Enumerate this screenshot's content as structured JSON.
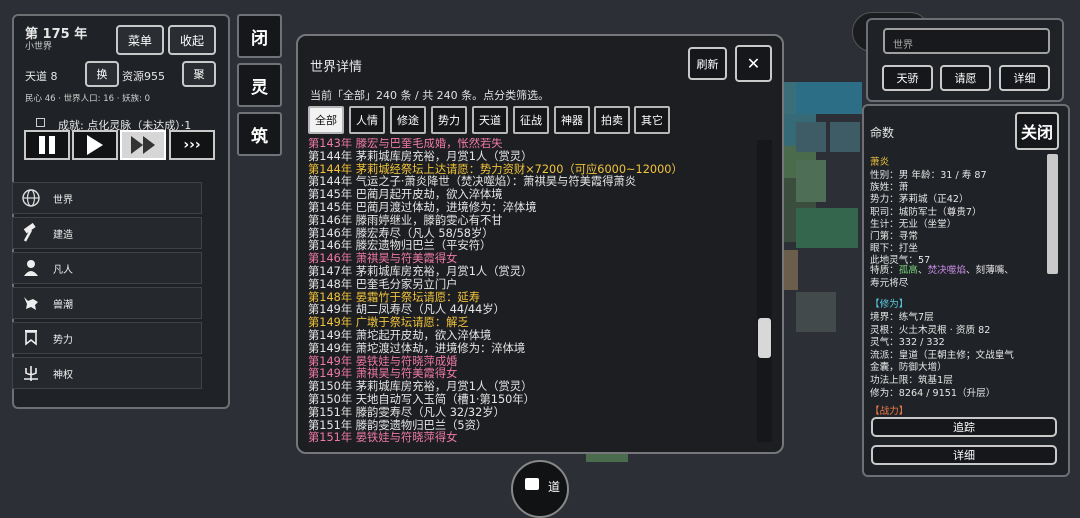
{
  "top_left": {
    "year": "第 175 年",
    "world_type": "小世界",
    "menu_label": "菜单",
    "collapse_label": "收起",
    "tiandao": "天道 8",
    "swap_label": "换",
    "resources": "资源955",
    "gather_label": "聚",
    "stats": "民心 46 · 世界人口: 16 · 妖族: 0",
    "achievement": "成就: 点化灵脉（未达成）·1"
  },
  "nav": [
    {
      "icon": "globe-icon",
      "label": "世界"
    },
    {
      "icon": "hammer-icon",
      "label": "建造"
    },
    {
      "icon": "person-icon",
      "label": "凡人"
    },
    {
      "icon": "wolf-icon",
      "label": "兽潮"
    },
    {
      "icon": "banner-icon",
      "label": "势力"
    },
    {
      "icon": "trident-icon",
      "label": "神权"
    }
  ],
  "side_buttons": [
    "闭",
    "灵",
    "筑"
  ],
  "world_dialog": {
    "title": "世界详情",
    "refresh_label": "刷新",
    "close_label": "✕",
    "summary": "当前「全部」240 条 / 共 240 条。点分类筛选。",
    "tabs": [
      "全部",
      "人情",
      "修途",
      "势力",
      "天道",
      "征战",
      "神器",
      "拍卖",
      "其它"
    ],
    "active_tab": "全部",
    "log": [
      {
        "text": "第143年 滕宏与巴奎毛成婚，怅然若失",
        "color": "#f07aa6"
      },
      {
        "text": "第144年 茅莉城库房充裕，月赏1人（赏灵）",
        "color": "#e6e6e6"
      },
      {
        "text": "第144年 茅莉城经祭坛上达请愿：势力资财×7200（可应6000~12000）",
        "color": "#f2c43d"
      },
      {
        "text": "第144年 气运之子·萧炎降世（焚决噬焰）：萧祺昊与符美霞得萧炎",
        "color": "#e6e6e6"
      },
      {
        "text": "第145年 巴蔺月起开皮劫，欲入淬体境",
        "color": "#e6e6e6"
      },
      {
        "text": "第145年 巴蔺月渡过体劫，进境修为：淬体境",
        "color": "#e6e6e6"
      },
      {
        "text": "第146年 滕雨婷继业，滕韵雯心有不甘",
        "color": "#e6e6e6"
      },
      {
        "text": "第146年 滕宏寿尽（凡人 58/58岁）",
        "color": "#e6e6e6"
      },
      {
        "text": "第146年 滕宏遗物归巴兰（平安符）",
        "color": "#e6e6e6"
      },
      {
        "text": "第146年 萧祺昊与符美霞得女",
        "color": "#f07aa6"
      },
      {
        "text": "第147年 茅莉城库房充裕，月赏1人（赏灵）",
        "color": "#e6e6e6"
      },
      {
        "text": "第148年 巴奎毛分家另立门户",
        "color": "#e6e6e6"
      },
      {
        "text": "第148年 晏霜竹于祭坛请愿：延寿",
        "color": "#f2c43d"
      },
      {
        "text": "第149年 胡二凤寿尽（凡人 44/44岁）",
        "color": "#e6e6e6"
      },
      {
        "text": "第149年 广墩于祭坛请愿：解乏",
        "color": "#f2c43d"
      },
      {
        "text": "第149年 萧坨起开皮劫，欲入淬体境",
        "color": "#e6e6e6"
      },
      {
        "text": "第149年 萧坨渡过体劫，进境修为：淬体境",
        "color": "#e6e6e6"
      },
      {
        "text": "第149年 晏铁娃与符晓萍成婚",
        "color": "#f07aa6"
      },
      {
        "text": "第149年 萧祺昊与符美霞得女",
        "color": "#f07aa6"
      },
      {
        "text": "第150年 茅莉城库房充裕，月赏1人（赏灵）",
        "color": "#e6e6e6"
      },
      {
        "text": "第150年 天地自动写入玉简（槽1·第150年）",
        "color": "#e6e6e6"
      },
      {
        "text": "第151年 滕韵雯寿尽（凡人 32/32岁）",
        "color": "#e6e6e6"
      },
      {
        "text": "第151年 滕韵雯遗物归巴兰（5资）",
        "color": "#e6e6e6"
      },
      {
        "text": "第151年 晏铁娃与符晓萍得女",
        "color": "#f07aa6"
      }
    ]
  },
  "right_top": {
    "input_placeholder": "世界",
    "buttons": [
      "天骄",
      "请愿",
      "详细"
    ]
  },
  "character": {
    "header": "命数",
    "close_label": "关闭",
    "name": "萧炎",
    "lines": [
      {
        "text": "性别：男   年龄：31 / 寿 87",
        "color": "#e6e6e6"
      },
      {
        "text": "族姓：萧",
        "color": "#e6e6e6"
      },
      {
        "text": "势力：茅莉城（正42）",
        "color": "#e6e6e6"
      },
      {
        "text": "职司：城防军士（尊贵7）",
        "color": "#e6e6e6"
      },
      {
        "text": "生计：无业（坐堂）",
        "color": "#e6e6e6"
      },
      {
        "text": "门第：寻常",
        "color": "#e6e6e6"
      },
      {
        "text": "眼下：打坐",
        "color": "#e6e6e6"
      },
      {
        "text": "此地灵气：57",
        "color": "#e6e6e6"
      }
    ],
    "traits_label": "特质：",
    "traits": [
      {
        "text": "孤高",
        "color": "#7ad17a"
      },
      {
        "text": "、",
        "color": "#e6e6e6"
      },
      {
        "text": "焚决噬焰",
        "color": "#c88ae6"
      },
      {
        "text": "、刻薄嘴、",
        "color": "#e6e6e6"
      }
    ],
    "traits_line2": "寿元将尽",
    "cultivation_header": "【修为】",
    "cultivation": [
      "境界：练气7层",
      "灵根：火土木灵根 · 资质 82",
      "灵气：332 / 332",
      "流派：皇道（王朝主修；文战皇气",
      "金囊，防御大增）",
      "功法上限：筑基1层",
      "修为：8264 / 9151（升层）"
    ],
    "combat_header": "【战力】",
    "track_label": "追踪",
    "detail_label": "详细"
  },
  "bottom_fragment": "道"
}
